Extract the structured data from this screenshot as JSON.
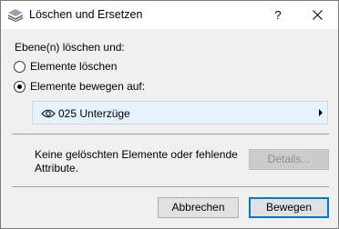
{
  "window": {
    "title": "Löschen und Ersetzen",
    "help_label": "?"
  },
  "form": {
    "section_label": "Ebene(n) löschen und:",
    "options": [
      {
        "label": "Elemente löschen",
        "selected": false
      },
      {
        "label": "Elemente bewegen auf:",
        "selected": true
      }
    ],
    "target_layer": {
      "icon": "eye-icon",
      "value": "025 Unterzüge"
    }
  },
  "status": {
    "message": "Keine gelöschten Elemente oder fehlende Attribute."
  },
  "buttons": {
    "details_label": "Details...",
    "cancel_label": "Abbrechen",
    "move_label": "Bewegen"
  },
  "colors": {
    "dialog_bg": "#f0f0f0",
    "select_bg": "#e5f1fb",
    "accent": "#0078d7"
  }
}
